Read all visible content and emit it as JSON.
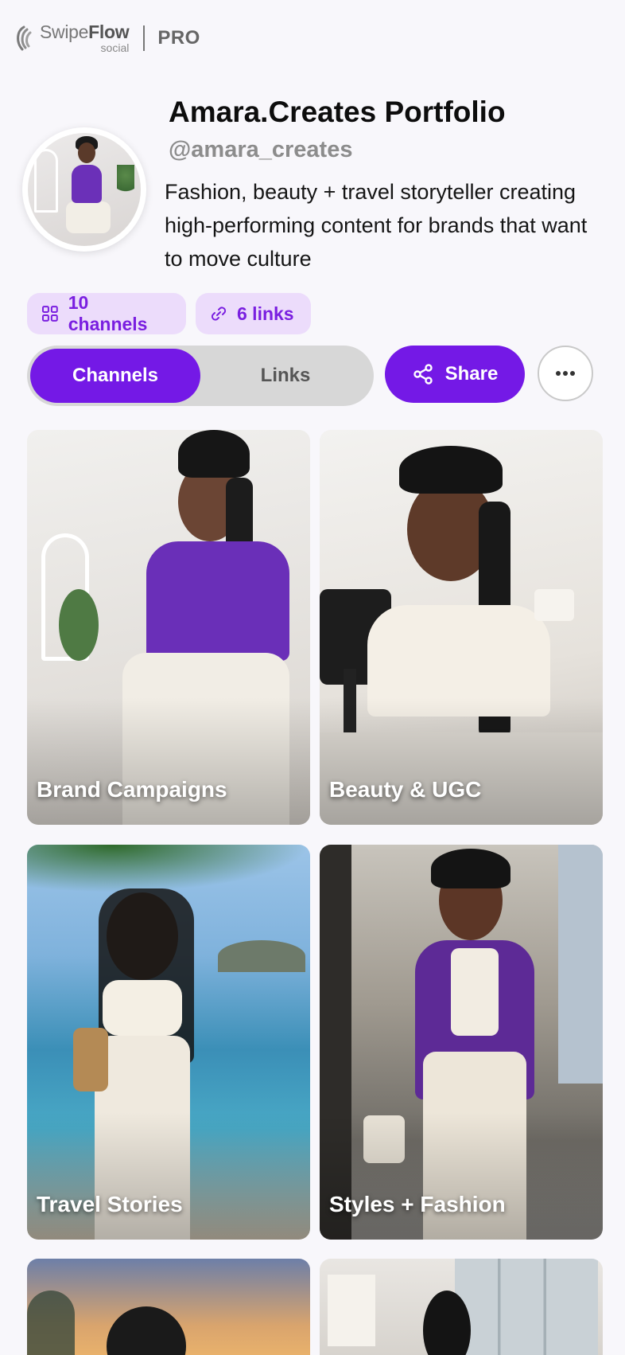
{
  "brand": {
    "logo_word_light": "Swipe",
    "logo_word_bold": "Flow",
    "logo_sub": "social",
    "tier": "PRO"
  },
  "profile": {
    "title": "Amara.Creates Portfolio",
    "handle": "@amara_creates",
    "bio": "Fashion, beauty + travel storyteller creating high-performing content for brands that want to move culture"
  },
  "stats": {
    "channels_label": "10 channels",
    "links_label": "6 links"
  },
  "tabs": {
    "channels": "Channels",
    "links": "Links",
    "active": "Channels"
  },
  "actions": {
    "share_label": "Share"
  },
  "icons": {
    "channels": "grid-icon",
    "links": "link-icon",
    "share": "share-icon",
    "more": "more-horizontal-icon"
  },
  "colors": {
    "accent": "#7419e6",
    "pill_bg": "#ecdcfb",
    "pill_text": "#7a1fe0",
    "background": "#f8f7fb"
  },
  "channels": [
    {
      "label": "Brand Campaigns"
    },
    {
      "label": "Beauty & UGC"
    },
    {
      "label": "Travel Stories"
    },
    {
      "label": "Styles + Fashion"
    },
    {
      "label": ""
    },
    {
      "label": ""
    }
  ]
}
